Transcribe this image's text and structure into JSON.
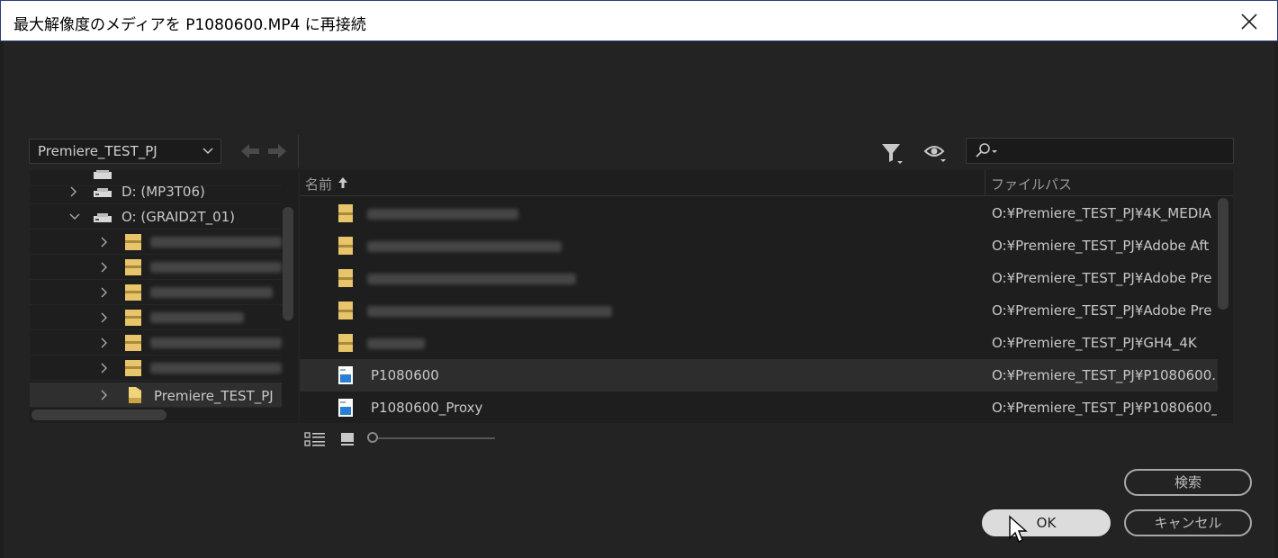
{
  "window": {
    "title": "最大解像度のメディアを P1080600.MP4 に再接続"
  },
  "toolbar": {
    "location": "Premiere_TEST_PJ",
    "search_placeholder": ""
  },
  "tree": {
    "drives": [
      {
        "label": "D: (MP3T06)",
        "expanded": false
      },
      {
        "label": "O: (GRAID2T_01)",
        "expanded": true
      }
    ],
    "selected_folder": "Premiere_TEST_PJ"
  },
  "list": {
    "col_name": "名前",
    "col_path": "ファイルパス",
    "rows": [
      {
        "name": "",
        "path": "O:¥Premiere_TEST_PJ¥4K_MEDIA",
        "type": "folder"
      },
      {
        "name": "",
        "path": "O:¥Premiere_TEST_PJ¥Adobe Aft",
        "type": "folder"
      },
      {
        "name": "",
        "path": "O:¥Premiere_TEST_PJ¥Adobe Pre",
        "type": "folder"
      },
      {
        "name": "",
        "path": "O:¥Premiere_TEST_PJ¥Adobe Pre",
        "type": "folder"
      },
      {
        "name": "",
        "path": "O:¥Premiere_TEST_PJ¥GH4_4K",
        "type": "folder"
      },
      {
        "name": "P1080600",
        "path": "O:¥Premiere_TEST_PJ¥P1080600.",
        "type": "file",
        "selected": true
      },
      {
        "name": "P1080600_Proxy",
        "path": "O:¥Premiere_TEST_PJ¥P1080600_",
        "type": "file"
      }
    ]
  },
  "buttons": {
    "search": "検索",
    "ok": "OK",
    "cancel": "キャンセル"
  },
  "colors": {
    "background": "#232323",
    "panel": "#1e1e1e",
    "folder": "#e8c46a",
    "file_icon": "#2a7fd4"
  },
  "icons": {
    "close": "close-icon",
    "filter": "filter-icon",
    "eye": "eye-icon",
    "search": "search-icon",
    "back": "arrow-left-icon",
    "forward": "arrow-right-icon"
  }
}
